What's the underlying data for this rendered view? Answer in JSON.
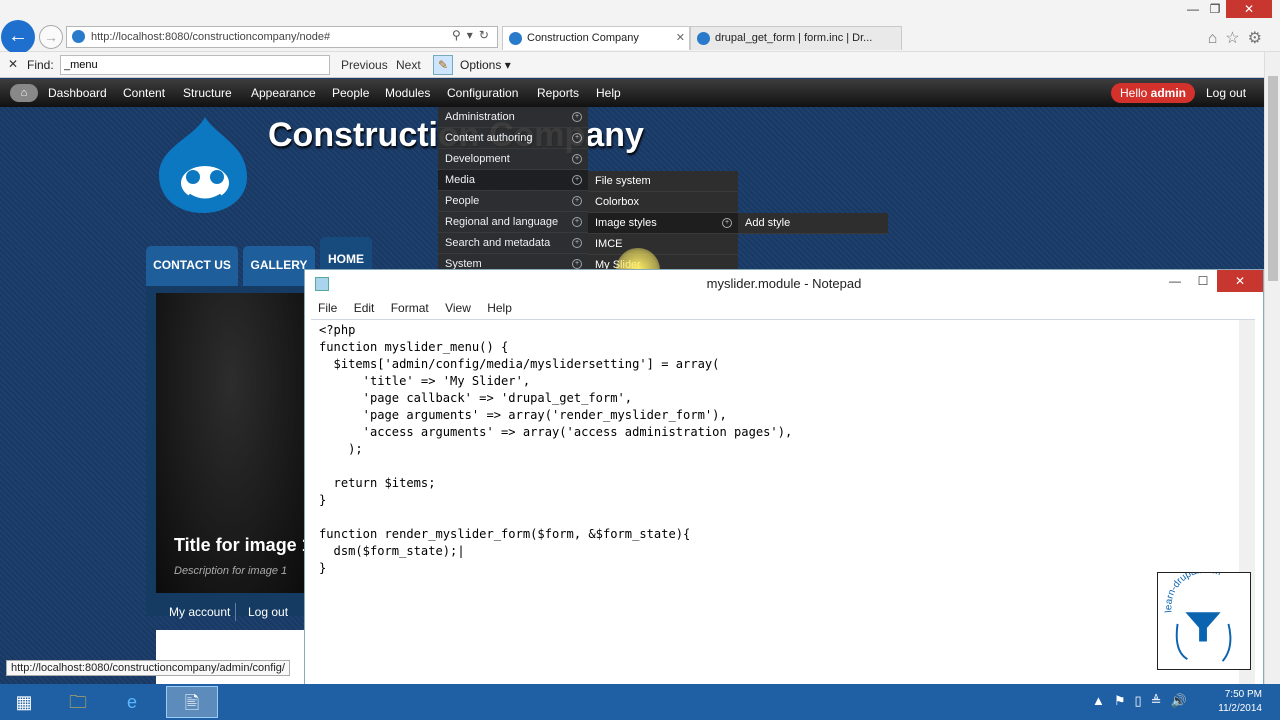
{
  "browser": {
    "url": "http://localhost:8080/constructioncompany/node#",
    "tabs": [
      {
        "label": "Construction Company"
      },
      {
        "label": "drupal_get_form | form.inc | Dr..."
      }
    ],
    "find": {
      "label": "Find:",
      "value": "_menu",
      "previous": "Previous",
      "next": "Next",
      "options": "Options"
    },
    "status_url": "http://localhost:8080/constructioncompany/admin/config/"
  },
  "toolbar": {
    "items": [
      "Dashboard",
      "Content",
      "Structure",
      "Appearance",
      "People",
      "Modules",
      "Configuration",
      "Reports",
      "Help"
    ],
    "hello_prefix": "Hello ",
    "hello_user": "admin",
    "logout": "Log out"
  },
  "site": {
    "title": "Construction Company",
    "nav": {
      "contact": "CONTACT US",
      "gallery": "GALLERY",
      "home": "HOME"
    },
    "slide_title": "Title for image 1",
    "slide_desc": "Description for image 1",
    "my_account": "My account",
    "logout": "Log out"
  },
  "menus": {
    "configuration": [
      "Administration",
      "Content authoring",
      "Development",
      "Media",
      "People",
      "Regional and language",
      "Search and metadata",
      "System"
    ],
    "media": [
      "File system",
      "Colorbox",
      "Image styles",
      "IMCE",
      "My Slider"
    ],
    "image_styles": [
      "Add style"
    ]
  },
  "notepad": {
    "title": "myslider.module - Notepad",
    "menu": [
      "File",
      "Edit",
      "Format",
      "View",
      "Help"
    ],
    "code": "<?php\nfunction myslider_menu() {\n  $items['admin/config/media/myslidersetting'] = array(\n      'title' => 'My Slider',\n      'page callback' => 'drupal_get_form',\n      'page arguments' => array('render_myslider_form'),\n      'access arguments' => array('access administration pages'),\n    );\n\n  return $items;\n}\n\nfunction render_myslider_form($form, &$form_state){\n  dsm($form_state);|\n}"
  },
  "watermark": "learn-drupal.com",
  "taskbar": {
    "time": "7:50 PM",
    "date": "11/2/2014"
  }
}
